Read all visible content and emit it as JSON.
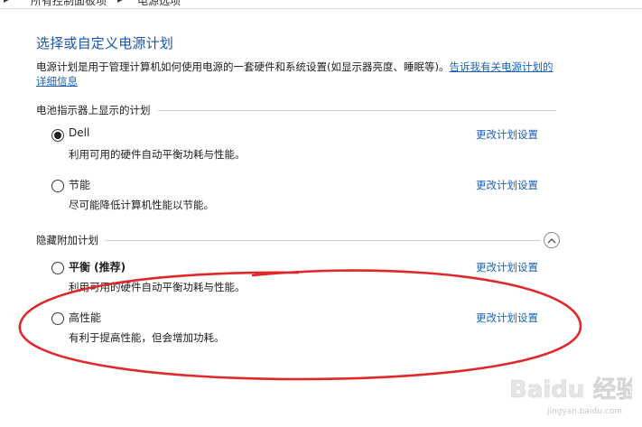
{
  "header": {
    "fragments": [
      "▸",
      "所有控制面板项",
      "▸",
      "电源选项"
    ]
  },
  "page": {
    "title": "选择或自定义电源计划",
    "description": "电源计划是用于管理计算机如何使用电源的一套硬件和系统设置(如显示器亮度、睡眠等)。",
    "help_link": "告诉我有关电源计划的详细信息"
  },
  "sections": {
    "battery": "电池指示器上显示的计划",
    "hidden": "隐藏附加计划"
  },
  "plans": [
    {
      "name": "Dell",
      "desc": "利用可用的硬件自动平衡功耗与性能。",
      "link": "更改计划设置",
      "selected": true
    },
    {
      "name": "节能",
      "desc": "尽可能降低计算机性能以节能。",
      "link": "更改计划设置",
      "selected": false
    },
    {
      "name": "平衡 (推荐)",
      "desc": "利用可用的硬件自动平衡功耗与性能。",
      "link": "更改计划设置",
      "selected": false
    },
    {
      "name": "高性能",
      "desc": "有利于提高性能，但会增加功耗。",
      "link": "更改计划设置",
      "selected": false
    }
  ],
  "annotation": {
    "color": "#e0282b"
  },
  "watermark": {
    "text": "Baidu 经验",
    "sub": "jingyan.baidu.com"
  },
  "icons": {
    "collapse": "chevron-up-icon"
  }
}
